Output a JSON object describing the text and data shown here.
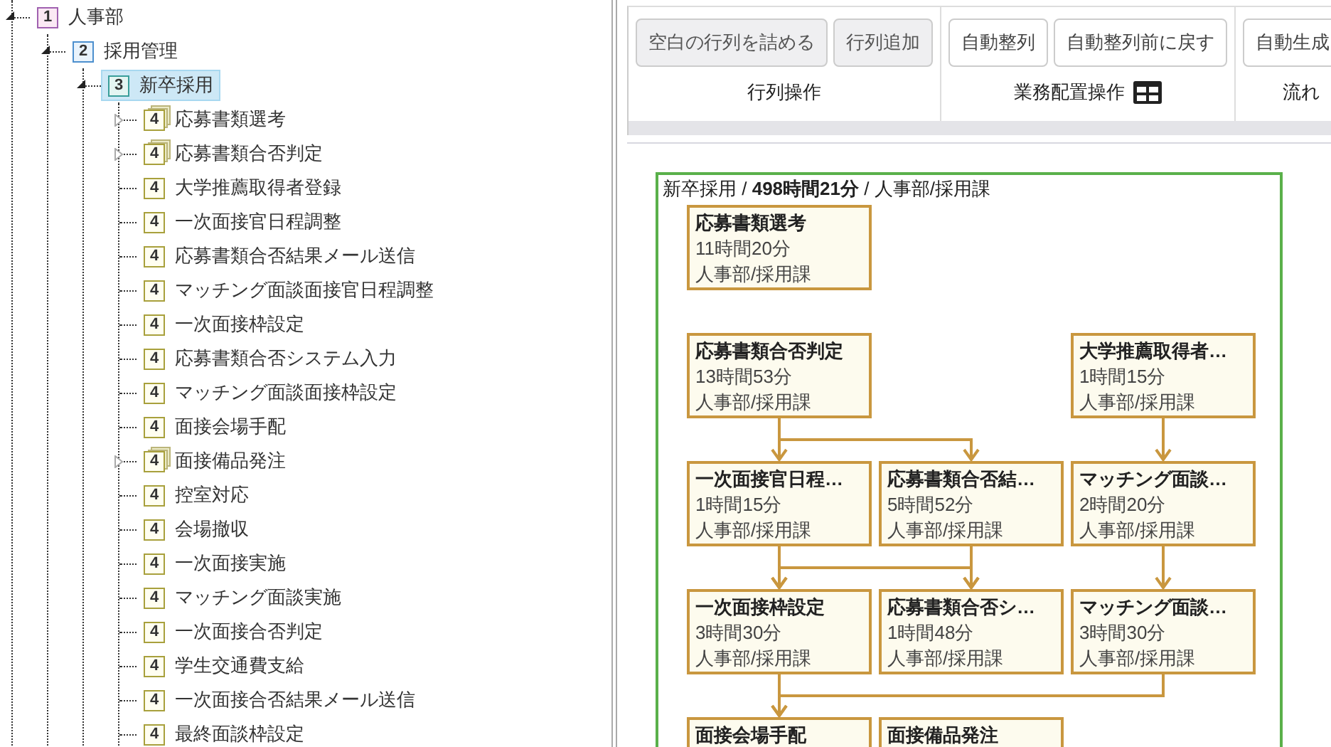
{
  "tree": [
    {
      "kind": "group",
      "badge": "1",
      "label": "人事部",
      "expanded": true,
      "selected": false,
      "children": [
        {
          "kind": "group",
          "badge": "2",
          "label": "採用管理",
          "expanded": true,
          "selected": false,
          "children": [
            {
              "kind": "group",
              "badge": "3",
              "label": "新卒採用",
              "expanded": true,
              "selected": true,
              "children": [
                {
                  "kind": "group",
                  "badge": "4",
                  "label": "応募書類選考",
                  "expanded": false,
                  "selected": false
                },
                {
                  "kind": "group",
                  "badge": "4",
                  "label": "応募書類合否判定",
                  "expanded": false,
                  "selected": false
                },
                {
                  "kind": "leaf",
                  "badge": "4",
                  "label": "大学推薦取得者登録",
                  "selected": false
                },
                {
                  "kind": "leaf",
                  "badge": "4",
                  "label": "一次面接官日程調整",
                  "selected": false
                },
                {
                  "kind": "leaf",
                  "badge": "4",
                  "label": "応募書類合否結果メール送信",
                  "selected": false
                },
                {
                  "kind": "leaf",
                  "badge": "4",
                  "label": "マッチング面談面接官日程調整",
                  "selected": false
                },
                {
                  "kind": "leaf",
                  "badge": "4",
                  "label": "一次面接枠設定",
                  "selected": false
                },
                {
                  "kind": "leaf",
                  "badge": "4",
                  "label": "応募書類合否システム入力",
                  "selected": false
                },
                {
                  "kind": "leaf",
                  "badge": "4",
                  "label": "マッチング面談面接枠設定",
                  "selected": false
                },
                {
                  "kind": "leaf",
                  "badge": "4",
                  "label": "面接会場手配",
                  "selected": false
                },
                {
                  "kind": "group",
                  "badge": "4",
                  "label": "面接備品発注",
                  "expanded": false,
                  "selected": false
                },
                {
                  "kind": "leaf",
                  "badge": "4",
                  "label": "控室対応",
                  "selected": false
                },
                {
                  "kind": "leaf",
                  "badge": "4",
                  "label": "会場撤収",
                  "selected": false
                },
                {
                  "kind": "leaf",
                  "badge": "4",
                  "label": "一次面接実施",
                  "selected": false
                },
                {
                  "kind": "leaf",
                  "badge": "4",
                  "label": "マッチング面談実施",
                  "selected": false
                },
                {
                  "kind": "leaf",
                  "badge": "4",
                  "label": "一次面接合否判定",
                  "selected": false
                },
                {
                  "kind": "leaf",
                  "badge": "4",
                  "label": "学生交通費支給",
                  "selected": false
                },
                {
                  "kind": "leaf",
                  "badge": "4",
                  "label": "一次面接合否結果メール送信",
                  "selected": false
                },
                {
                  "kind": "leaf",
                  "badge": "4",
                  "label": "最終面談枠設定",
                  "selected": false
                }
              ]
            }
          ]
        }
      ]
    }
  ],
  "ribbon": {
    "groups": [
      {
        "label": "行列操作",
        "grid_icon": false,
        "buttons": [
          {
            "label": "空白の行列を詰める",
            "disabled": true
          },
          {
            "label": "行列追加",
            "disabled": true
          }
        ]
      },
      {
        "label": "業務配置操作",
        "grid_icon": true,
        "buttons": [
          {
            "label": "自動整列",
            "disabled": false
          },
          {
            "label": "自動整列前に戻す",
            "disabled": false
          }
        ]
      },
      {
        "label": "流れ",
        "grid_icon": false,
        "buttons": [
          {
            "label": "自動生成",
            "disabled": false
          }
        ]
      }
    ]
  },
  "flow": {
    "title": "新卒採用 / **498時間21分** / 人事部/採用課",
    "rows": [
      [
        {
          "title": "応募書類選考",
          "time": "11時間20分",
          "dept": "人事部/採用課"
        },
        null,
        null
      ],
      [
        {
          "title": "応募書類合否判定",
          "time": "13時間53分",
          "dept": "人事部/採用課"
        },
        null,
        {
          "title": "大学推薦取得者…",
          "time": "1時間15分",
          "dept": "人事部/採用課"
        }
      ],
      [
        {
          "title": "一次面接官日程…",
          "time": "1時間15分",
          "dept": "人事部/採用課"
        },
        {
          "title": "応募書類合否結…",
          "time": "5時間52分",
          "dept": "人事部/採用課"
        },
        {
          "title": "マッチング面談…",
          "time": "2時間20分",
          "dept": "人事部/採用課"
        }
      ],
      [
        {
          "title": "一次面接枠設定",
          "time": "3時間30分",
          "dept": "人事部/採用課"
        },
        {
          "title": "応募書類合否シ…",
          "time": "1時間48分",
          "dept": "人事部/採用課"
        },
        {
          "title": "マッチング面談…",
          "time": "3時間30分",
          "dept": "人事部/採用課"
        }
      ],
      [
        {
          "title": "面接会場手配"
        },
        {
          "title": "面接備品発注"
        },
        null
      ]
    ]
  }
}
